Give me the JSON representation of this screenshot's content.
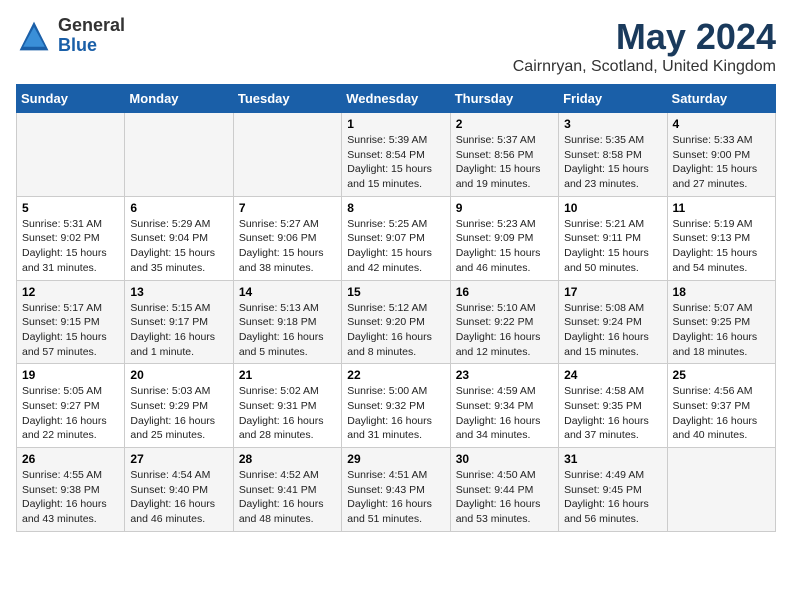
{
  "header": {
    "logo_general": "General",
    "logo_blue": "Blue",
    "title": "May 2024",
    "subtitle": "Cairnryan, Scotland, United Kingdom"
  },
  "days_of_week": [
    "Sunday",
    "Monday",
    "Tuesday",
    "Wednesday",
    "Thursday",
    "Friday",
    "Saturday"
  ],
  "weeks": [
    [
      {
        "day": "",
        "info": ""
      },
      {
        "day": "",
        "info": ""
      },
      {
        "day": "",
        "info": ""
      },
      {
        "day": "1",
        "info": "Sunrise: 5:39 AM\nSunset: 8:54 PM\nDaylight: 15 hours\nand 15 minutes."
      },
      {
        "day": "2",
        "info": "Sunrise: 5:37 AM\nSunset: 8:56 PM\nDaylight: 15 hours\nand 19 minutes."
      },
      {
        "day": "3",
        "info": "Sunrise: 5:35 AM\nSunset: 8:58 PM\nDaylight: 15 hours\nand 23 minutes."
      },
      {
        "day": "4",
        "info": "Sunrise: 5:33 AM\nSunset: 9:00 PM\nDaylight: 15 hours\nand 27 minutes."
      }
    ],
    [
      {
        "day": "5",
        "info": "Sunrise: 5:31 AM\nSunset: 9:02 PM\nDaylight: 15 hours\nand 31 minutes."
      },
      {
        "day": "6",
        "info": "Sunrise: 5:29 AM\nSunset: 9:04 PM\nDaylight: 15 hours\nand 35 minutes."
      },
      {
        "day": "7",
        "info": "Sunrise: 5:27 AM\nSunset: 9:06 PM\nDaylight: 15 hours\nand 38 minutes."
      },
      {
        "day": "8",
        "info": "Sunrise: 5:25 AM\nSunset: 9:07 PM\nDaylight: 15 hours\nand 42 minutes."
      },
      {
        "day": "9",
        "info": "Sunrise: 5:23 AM\nSunset: 9:09 PM\nDaylight: 15 hours\nand 46 minutes."
      },
      {
        "day": "10",
        "info": "Sunrise: 5:21 AM\nSunset: 9:11 PM\nDaylight: 15 hours\nand 50 minutes."
      },
      {
        "day": "11",
        "info": "Sunrise: 5:19 AM\nSunset: 9:13 PM\nDaylight: 15 hours\nand 54 minutes."
      }
    ],
    [
      {
        "day": "12",
        "info": "Sunrise: 5:17 AM\nSunset: 9:15 PM\nDaylight: 15 hours\nand 57 minutes."
      },
      {
        "day": "13",
        "info": "Sunrise: 5:15 AM\nSunset: 9:17 PM\nDaylight: 16 hours\nand 1 minute."
      },
      {
        "day": "14",
        "info": "Sunrise: 5:13 AM\nSunset: 9:18 PM\nDaylight: 16 hours\nand 5 minutes."
      },
      {
        "day": "15",
        "info": "Sunrise: 5:12 AM\nSunset: 9:20 PM\nDaylight: 16 hours\nand 8 minutes."
      },
      {
        "day": "16",
        "info": "Sunrise: 5:10 AM\nSunset: 9:22 PM\nDaylight: 16 hours\nand 12 minutes."
      },
      {
        "day": "17",
        "info": "Sunrise: 5:08 AM\nSunset: 9:24 PM\nDaylight: 16 hours\nand 15 minutes."
      },
      {
        "day": "18",
        "info": "Sunrise: 5:07 AM\nSunset: 9:25 PM\nDaylight: 16 hours\nand 18 minutes."
      }
    ],
    [
      {
        "day": "19",
        "info": "Sunrise: 5:05 AM\nSunset: 9:27 PM\nDaylight: 16 hours\nand 22 minutes."
      },
      {
        "day": "20",
        "info": "Sunrise: 5:03 AM\nSunset: 9:29 PM\nDaylight: 16 hours\nand 25 minutes."
      },
      {
        "day": "21",
        "info": "Sunrise: 5:02 AM\nSunset: 9:31 PM\nDaylight: 16 hours\nand 28 minutes."
      },
      {
        "day": "22",
        "info": "Sunrise: 5:00 AM\nSunset: 9:32 PM\nDaylight: 16 hours\nand 31 minutes."
      },
      {
        "day": "23",
        "info": "Sunrise: 4:59 AM\nSunset: 9:34 PM\nDaylight: 16 hours\nand 34 minutes."
      },
      {
        "day": "24",
        "info": "Sunrise: 4:58 AM\nSunset: 9:35 PM\nDaylight: 16 hours\nand 37 minutes."
      },
      {
        "day": "25",
        "info": "Sunrise: 4:56 AM\nSunset: 9:37 PM\nDaylight: 16 hours\nand 40 minutes."
      }
    ],
    [
      {
        "day": "26",
        "info": "Sunrise: 4:55 AM\nSunset: 9:38 PM\nDaylight: 16 hours\nand 43 minutes."
      },
      {
        "day": "27",
        "info": "Sunrise: 4:54 AM\nSunset: 9:40 PM\nDaylight: 16 hours\nand 46 minutes."
      },
      {
        "day": "28",
        "info": "Sunrise: 4:52 AM\nSunset: 9:41 PM\nDaylight: 16 hours\nand 48 minutes."
      },
      {
        "day": "29",
        "info": "Sunrise: 4:51 AM\nSunset: 9:43 PM\nDaylight: 16 hours\nand 51 minutes."
      },
      {
        "day": "30",
        "info": "Sunrise: 4:50 AM\nSunset: 9:44 PM\nDaylight: 16 hours\nand 53 minutes."
      },
      {
        "day": "31",
        "info": "Sunrise: 4:49 AM\nSunset: 9:45 PM\nDaylight: 16 hours\nand 56 minutes."
      },
      {
        "day": "",
        "info": ""
      }
    ]
  ]
}
